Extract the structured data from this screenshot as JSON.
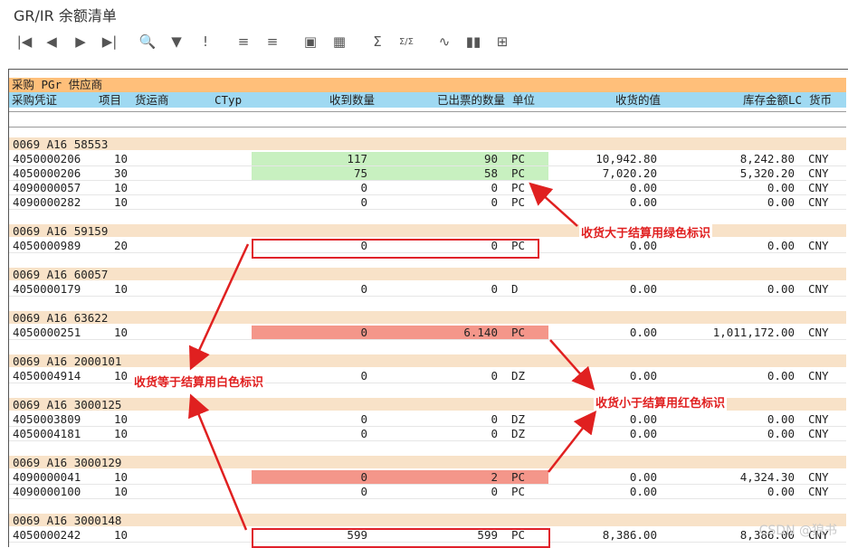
{
  "title": "GR/IR 余额清单",
  "toolbar": [
    {
      "name": "first-page-icon",
      "glyph": "|◀"
    },
    {
      "name": "previous-page-icon",
      "glyph": "◀"
    },
    {
      "name": "next-page-icon",
      "glyph": "▶"
    },
    {
      "name": "last-page-icon",
      "glyph": "▶|"
    },
    {
      "name": "find-icon",
      "glyph": "🔍"
    },
    {
      "name": "filter-icon",
      "glyph": "▼"
    },
    {
      "name": "details-icon",
      "glyph": "!"
    },
    {
      "name": "sort-ascending-icon",
      "glyph": "≡"
    },
    {
      "name": "sort-descending-icon",
      "glyph": "≡"
    },
    {
      "name": "layout-icon",
      "glyph": "▣"
    },
    {
      "name": "grid-icon",
      "glyph": "▦"
    },
    {
      "name": "sum-icon",
      "glyph": "Σ"
    },
    {
      "name": "subtotal-icon",
      "glyph": "Σ/Σ"
    },
    {
      "name": "graph-icon",
      "glyph": "∿"
    },
    {
      "name": "chart-icon",
      "glyph": "▮▮"
    },
    {
      "name": "export-icon",
      "glyph": "⊞"
    }
  ],
  "header1": "采购 PGr 供应商",
  "header2": {
    "doc": "采购凭证",
    "item": "项目",
    "shipper": "货运商",
    "ctyp": "CTyp",
    "recv_qty": "收到数量",
    "inv_qty": "已出票的数量",
    "unit": "单位",
    "recv_value": "收货的值",
    "stock_amt": "库存金额LC",
    "currency": "货币"
  },
  "groups": [
    {
      "label": "0069 A16 58553",
      "rows": [
        {
          "doc": "4050000206",
          "item": "10",
          "recv": "117",
          "inv": "90",
          "unit": "PC",
          "rval": "10,942.80",
          "stock": "8,242.80",
          "cur": "CNY",
          "hl": "green"
        },
        {
          "doc": "4050000206",
          "item": "30",
          "recv": "75",
          "inv": "58",
          "unit": "PC",
          "rval": "7,020.20",
          "stock": "5,320.20",
          "cur": "CNY",
          "hl": "green"
        },
        {
          "doc": "4090000057",
          "item": "10",
          "recv": "0",
          "inv": "0",
          "unit": "PC",
          "rval": "0.00",
          "stock": "0.00",
          "cur": "CNY",
          "hl": ""
        },
        {
          "doc": "4090000282",
          "item": "10",
          "recv": "0",
          "inv": "0",
          "unit": "PC",
          "rval": "0.00",
          "stock": "0.00",
          "cur": "CNY",
          "hl": ""
        }
      ]
    },
    {
      "label": "0069 A16 59159",
      "rows": [
        {
          "doc": "4050000989",
          "item": "20",
          "recv": "0",
          "inv": "0",
          "unit": "PC",
          "rval": "0.00",
          "stock": "0.00",
          "cur": "CNY",
          "hl": ""
        }
      ]
    },
    {
      "label": "0069 A16 60057",
      "rows": [
        {
          "doc": "4050000179",
          "item": "10",
          "recv": "0",
          "inv": "0",
          "unit": "D",
          "rval": "0.00",
          "stock": "0.00",
          "cur": "CNY",
          "hl": ""
        }
      ]
    },
    {
      "label": "0069 A16 63622",
      "rows": [
        {
          "doc": "4050000251",
          "item": "10",
          "recv": "0",
          "inv": "6.140",
          "unit": "PC",
          "rval": "0.00",
          "stock": "1,011,172.00",
          "cur": "CNY",
          "hl": "red"
        }
      ]
    },
    {
      "label": "0069 A16 2000101",
      "rows": [
        {
          "doc": "4050004914",
          "item": "10",
          "recv": "0",
          "inv": "0",
          "unit": "DZ",
          "rval": "0.00",
          "stock": "0.00",
          "cur": "CNY",
          "hl": ""
        }
      ]
    },
    {
      "label": "0069 A16 3000125",
      "rows": [
        {
          "doc": "4050003809",
          "item": "10",
          "recv": "0",
          "inv": "0",
          "unit": "DZ",
          "rval": "0.00",
          "stock": "0.00",
          "cur": "CNY",
          "hl": ""
        },
        {
          "doc": "4050004181",
          "item": "10",
          "recv": "0",
          "inv": "0",
          "unit": "DZ",
          "rval": "0.00",
          "stock": "0.00",
          "cur": "CNY",
          "hl": ""
        }
      ]
    },
    {
      "label": "0069 A16 3000129",
      "rows": [
        {
          "doc": "4090000041",
          "item": "10",
          "recv": "0",
          "inv": "2",
          "unit": "PC",
          "rval": "0.00",
          "stock": "4,324.30",
          "cur": "CNY",
          "hl": "red"
        },
        {
          "doc": "4090000100",
          "item": "10",
          "recv": "0",
          "inv": "0",
          "unit": "PC",
          "rval": "0.00",
          "stock": "0.00",
          "cur": "CNY",
          "hl": ""
        }
      ]
    },
    {
      "label": "0069 A16 3000148",
      "rows": [
        {
          "doc": "4050000242",
          "item": "10",
          "recv": "599",
          "inv": "599",
          "unit": "PC",
          "rval": "8,386.00",
          "stock": "8,386.00",
          "cur": "CNY",
          "hl": ""
        }
      ]
    }
  ],
  "annotations": {
    "green": "收货大于结算用绿色标识",
    "white": "收货等于结算用白色标识",
    "red": "收货小于结算用红色标识"
  },
  "watermark": "CSDN @狼书",
  "colors": {
    "header1": "#ffbf7a",
    "header2": "#9fd9f2",
    "group": "#f8e2c8",
    "green": "#c8f0c0",
    "red": "#f4968a",
    "annotation": "#e02020"
  }
}
